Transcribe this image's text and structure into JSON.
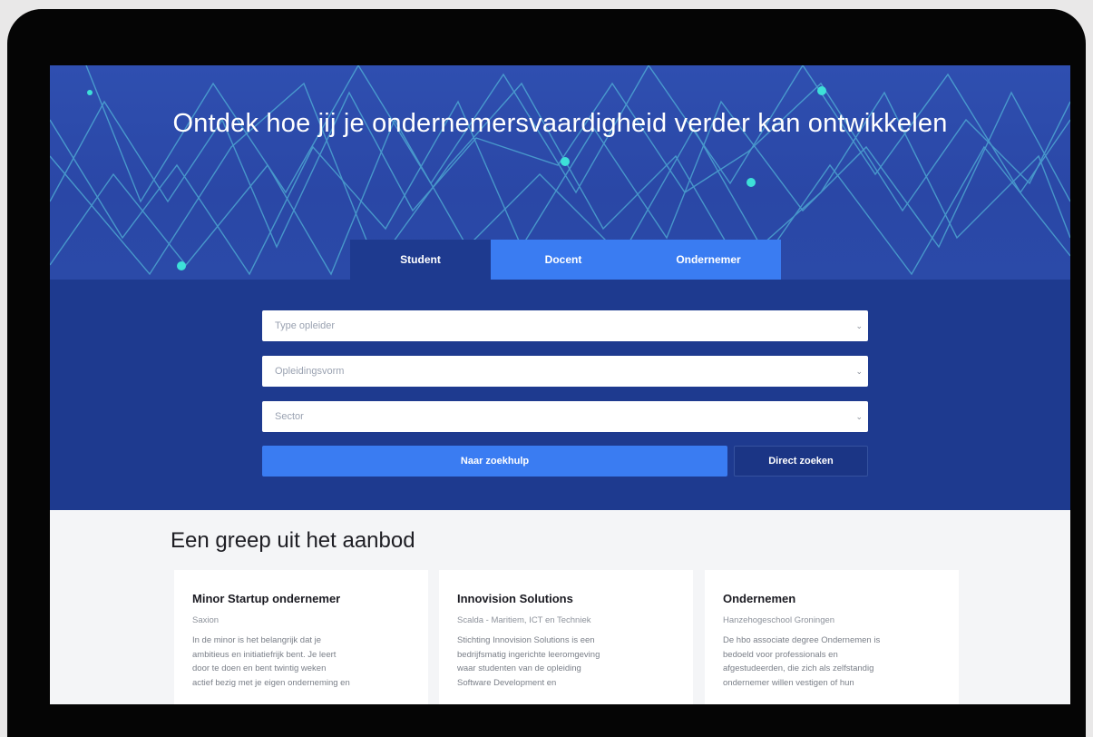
{
  "hero": {
    "title": "Ontdek hoe jij je ondernemersvaardigheid verder kan ontwikkelen",
    "colors": {
      "background": "#2f4fb0",
      "lines": "#5fd8e8",
      "dots": "#3de0d8"
    }
  },
  "tabs": [
    {
      "label": "Student",
      "active": true
    },
    {
      "label": "Docent",
      "active": false
    },
    {
      "label": "Ondernemer",
      "active": false
    }
  ],
  "search": {
    "fields": [
      {
        "placeholder": "Type opleider",
        "icon": "chevron-down-icon"
      },
      {
        "placeholder": "Opleidingsvorm",
        "icon": "chevron-down-icon"
      },
      {
        "placeholder": "Sector",
        "icon": "chevron-down-icon"
      }
    ],
    "primary_button": "Naar zoekhulp",
    "secondary_button": "Direct zoeken",
    "colors": {
      "panel": "#1e3a8f",
      "primary": "#3a7cf2"
    }
  },
  "offer": {
    "title": "Een greep uit het aanbod",
    "cards": [
      {
        "title": "Minor Startup ondernemer",
        "subtitle": "Saxion",
        "lines": [
          "In de minor is het belangrijk dat je",
          "ambitieus en initiatiefrijk bent. Je leert",
          "door te doen en bent twintig weken",
          "actief bezig met je eigen onderneming en"
        ]
      },
      {
        "title": "Innovision Solutions",
        "subtitle": "Scalda - Maritiem, ICT en Techniek",
        "lines": [
          "Stichting Innovision Solutions is een",
          "bedrijfsmatig ingerichte leeromgeving",
          "waar studenten van de opleiding",
          "Software Development en"
        ]
      },
      {
        "title": "Ondernemen",
        "subtitle": "Hanzehogeschool Groningen",
        "lines": [
          "De hbo associate degree Ondernemen is",
          "bedoeld voor professionals en",
          "afgestudeerden, die zich als zelfstandig",
          "ondernemer willen vestigen of hun"
        ]
      }
    ]
  }
}
